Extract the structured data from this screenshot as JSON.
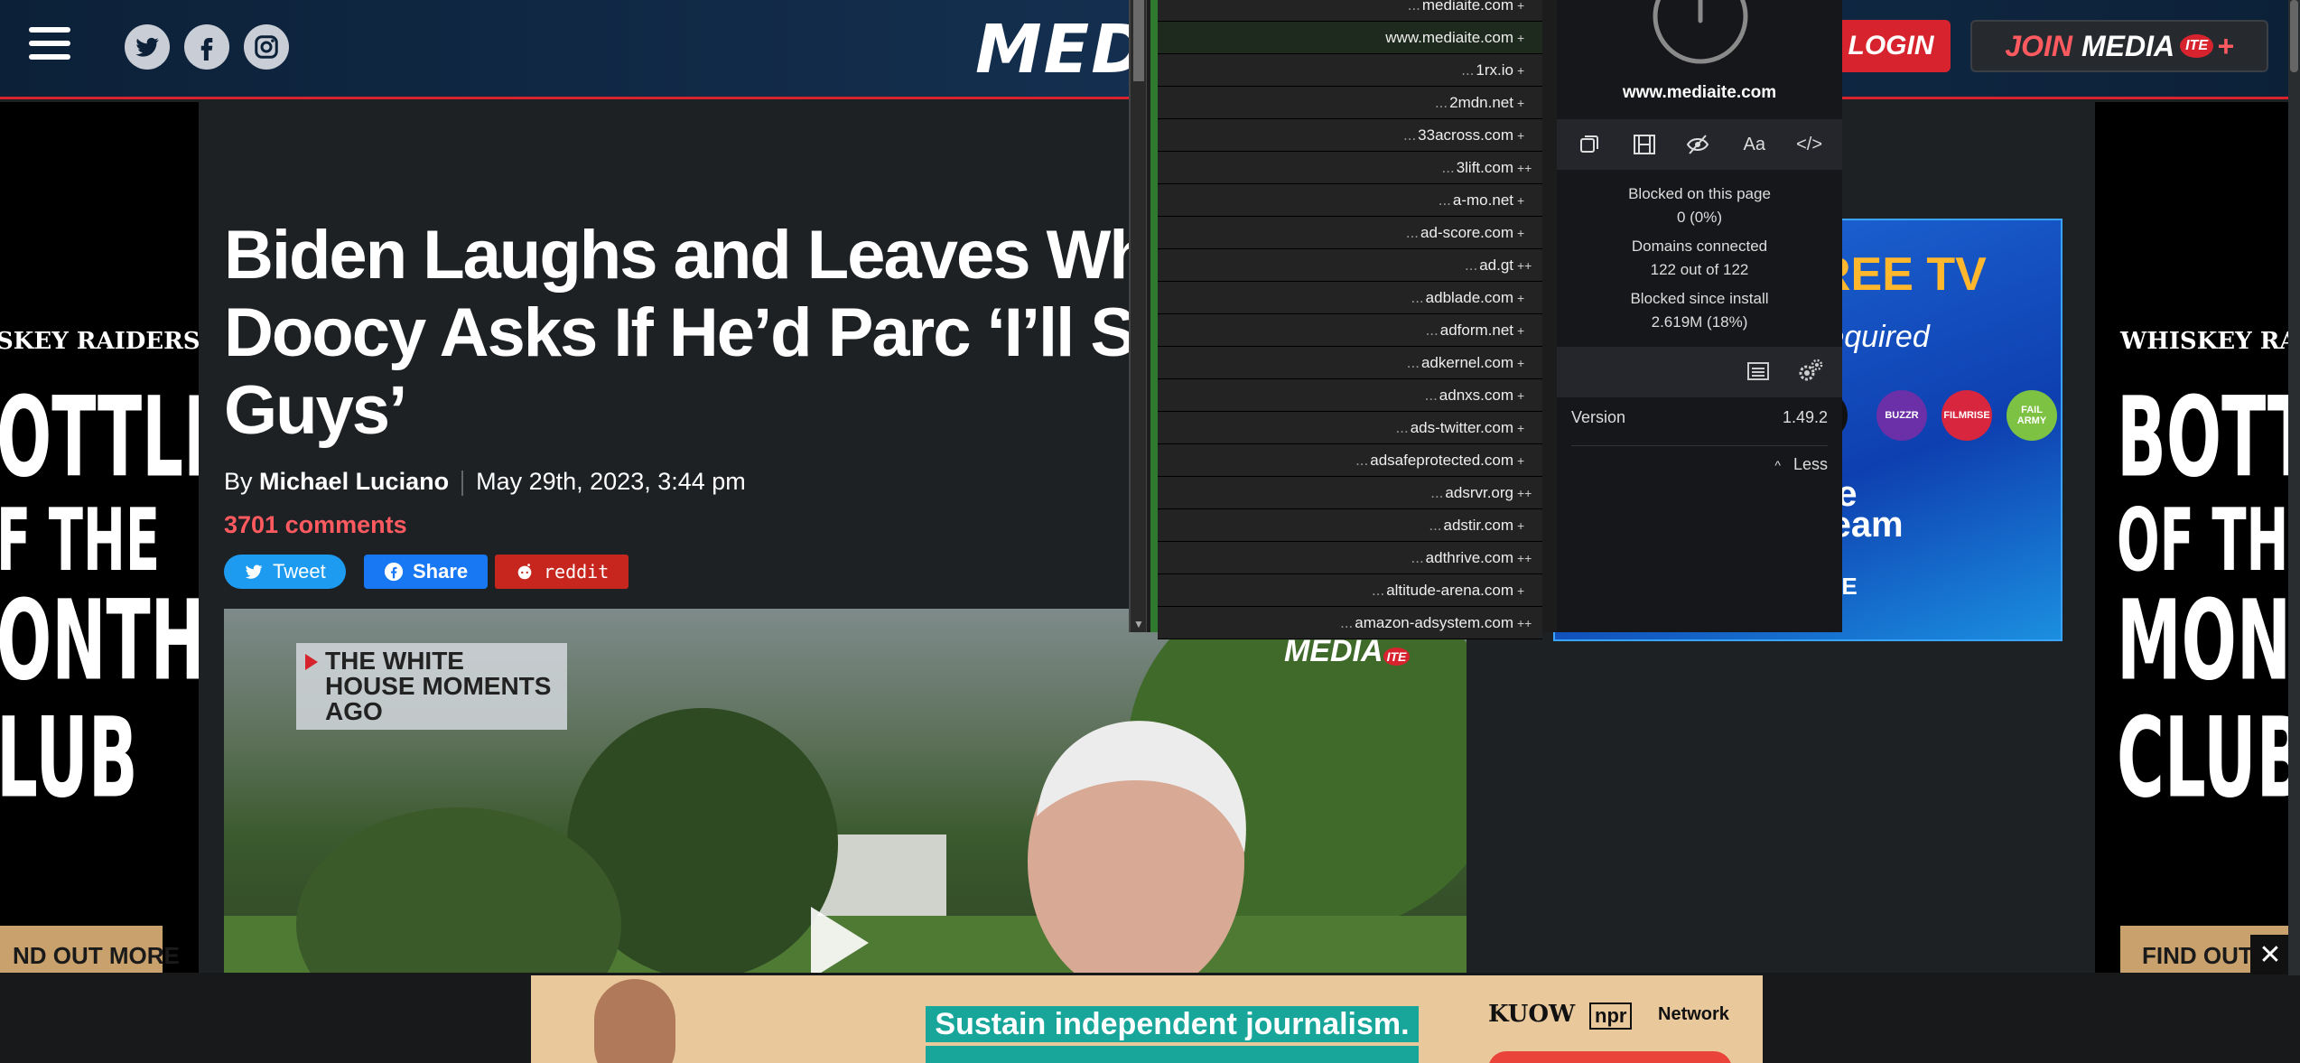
{
  "header": {
    "logo": "MED",
    "login_label": "LOGIN",
    "join_label_1": "JOIN",
    "join_label_2": "MEDIA",
    "join_label_3": "ITE",
    "join_label_4": "+"
  },
  "side_ads": {
    "left": {
      "brand": "SKEY RAIDERS",
      "line1": "OTTLE",
      "line2": "F THE",
      "line3": "ONTH",
      "line4": "LUB",
      "cta": "ND OUT MORE"
    },
    "right": {
      "brand": "WHISKEY RAI",
      "line1": "BOTTL",
      "line2": "OF TH",
      "line3": "MONT",
      "line4": "CLUB",
      "cta": "FIND OUT"
    }
  },
  "article": {
    "headline": "Biden Laughs and Leaves Wh Peter Doocy Asks If He’d Parc ‘I’ll See You Guys’",
    "by": "By",
    "author": "Michael Luciano",
    "date": "May 29th, 2023, 3:44 pm",
    "comments": "3701 comments",
    "share_tweet": "Tweet",
    "share_facebook": "Share",
    "share_reddit": "reddit",
    "video": {
      "chyron": "THE WHITE HOUSE MOMENTS AGO",
      "watermark": "MEDIA",
      "watermark_badge": "ITE"
    }
  },
  "promo_ad": {
    "headline": "REE TV",
    "subheadline": "required",
    "channels": [
      "",
      "BUZZR",
      "FILMRISE",
      "FAIL ARMY"
    ],
    "line3": "ee",
    "line4": "ream",
    "pill": "EE"
  },
  "bottom_ad": {
    "message": "Sustain independent journalism.",
    "kuow": "KUOW",
    "npr": "npr",
    "network": "Network",
    "close_label": "✕"
  },
  "ublock": {
    "domains": [
      {
        "prefix": "...",
        "name": "mediaite.com",
        "mark": "+"
      },
      {
        "prefix": "",
        "name": "www.mediaite.com",
        "mark": "+"
      },
      {
        "prefix": "...",
        "name": "1rx.io",
        "mark": "+"
      },
      {
        "prefix": "...",
        "name": "2mdn.net",
        "mark": "+"
      },
      {
        "prefix": "...",
        "name": "33across.com",
        "mark": "+"
      },
      {
        "prefix": "...",
        "name": "3lift.com",
        "mark": "++"
      },
      {
        "prefix": "...",
        "name": "a-mo.net",
        "mark": "+"
      },
      {
        "prefix": "...",
        "name": "ad-score.com",
        "mark": "+"
      },
      {
        "prefix": "...",
        "name": "ad.gt",
        "mark": "++"
      },
      {
        "prefix": "...",
        "name": "adblade.com",
        "mark": "+"
      },
      {
        "prefix": "...",
        "name": "adform.net",
        "mark": "+"
      },
      {
        "prefix": "...",
        "name": "adkernel.com",
        "mark": "+"
      },
      {
        "prefix": "...",
        "name": "adnxs.com",
        "mark": "+"
      },
      {
        "prefix": "...",
        "name": "ads-twitter.com",
        "mark": "+"
      },
      {
        "prefix": "...",
        "name": "adsafeprotected.com",
        "mark": "+"
      },
      {
        "prefix": "...",
        "name": "adsrvr.org",
        "mark": "++"
      },
      {
        "prefix": "...",
        "name": "adstir.com",
        "mark": "+"
      },
      {
        "prefix": "...",
        "name": "adthrive.com",
        "mark": "++"
      },
      {
        "prefix": "...",
        "name": "altitude-arena.com",
        "mark": "+"
      },
      {
        "prefix": "...",
        "name": "amazon-adsystem.com",
        "mark": "++"
      }
    ],
    "site": "www.mediaite.com",
    "blocked_label": "Blocked on this page",
    "blocked_value": "0 (0%)",
    "domains_label": "Domains connected",
    "domains_value": "122 out of 122",
    "since_label": "Blocked since install",
    "since_value": "2.619M (18%)",
    "version_label": "Version",
    "version_value": "1.49.2",
    "less_label": "Less",
    "tool_icons": [
      "popup-block-icon",
      "media-block-icon",
      "cosmetic-filter-icon",
      "font-block-icon",
      "script-block-icon"
    ],
    "tool_labels": {
      "font": "Aa",
      "script": "</>"
    }
  },
  "colors": {
    "accent_red": "#d7232d",
    "comments_red": "#ff5a5f",
    "twitter_blue": "#1d9bf0",
    "facebook_blue": "#1877f2",
    "reddit_red": "#c6261d",
    "ublock_green": "#2f7a2f"
  }
}
